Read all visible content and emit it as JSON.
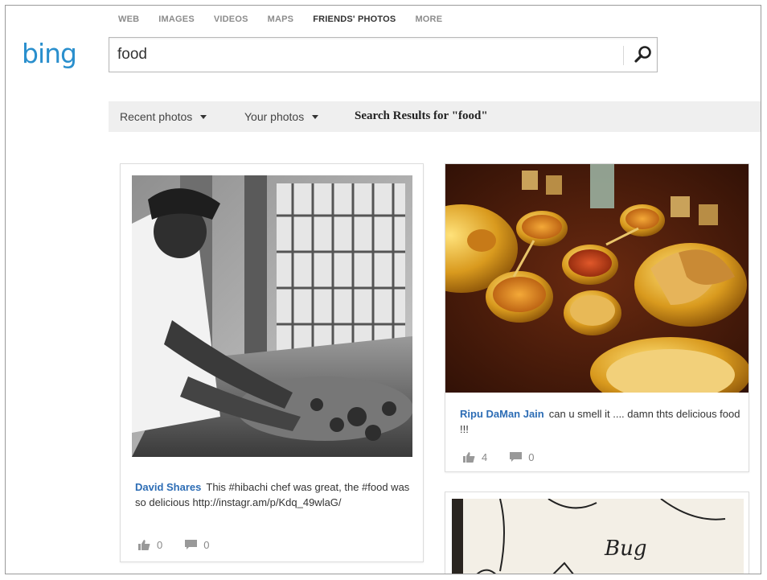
{
  "nav": {
    "items": [
      "WEB",
      "IMAGES",
      "VIDEOS",
      "MAPS",
      "FRIENDS' PHOTOS",
      "MORE"
    ],
    "active_index": 4
  },
  "logo": {
    "text": "bing",
    "color": "#2a8fcd"
  },
  "search": {
    "query": "food",
    "button_icon": "search-icon"
  },
  "filters": {
    "recent": "Recent photos",
    "yours": "Your photos",
    "results_title": "Search Results for \"food\""
  },
  "cards": [
    {
      "author": "David Shares",
      "text": "This #hibachi chef was great, the #food was so delicious http://instagr.am/p/Kdq_49wlaG/",
      "likes": "0",
      "comments": "0"
    },
    {
      "author": "Ripu DaMan Jain",
      "text": "can u smell it .... damn thts delicious food !!!",
      "likes": "4",
      "comments": "0"
    }
  ],
  "third_card": {
    "handwriting": "Bug"
  },
  "colors": {
    "link": "#2d6db5",
    "accent": "#2a8fcd",
    "filterbar": "#efefef"
  }
}
